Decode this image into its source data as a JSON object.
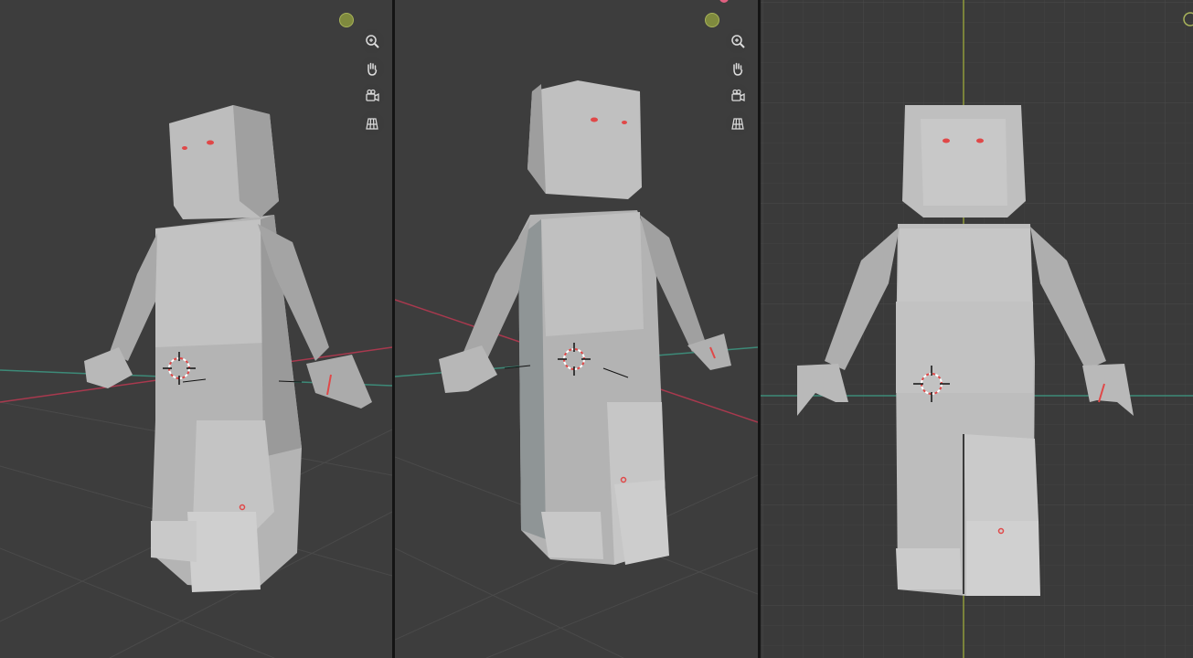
{
  "viewports": [
    {
      "id": "perspective-left",
      "view": "user-perspective"
    },
    {
      "id": "perspective-right",
      "view": "user-perspective"
    },
    {
      "id": "front-orthographic",
      "view": "front-orthographic"
    }
  ],
  "navigation_icons": [
    "zoom-icon",
    "pan-hand-icon",
    "camera-view-icon",
    "orthographic-grid-icon"
  ],
  "colors": {
    "viewport_bg": "#3d3d3d",
    "model": "#b9b9b9",
    "eye_highlight": "#e04848",
    "x_axis": "#a8394e",
    "y_axis": "#3d8a78",
    "z_axis": "#8f9a3a",
    "gizmo_dot": "#7f8a3e"
  }
}
